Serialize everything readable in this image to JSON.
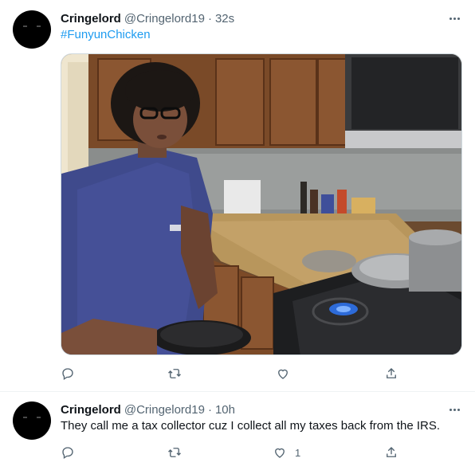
{
  "tweets": [
    {
      "author": {
        "name": "Cringelord",
        "handle": "@Cringelord19"
      },
      "separator": "·",
      "time": "32s",
      "hashtag": "#FunyunChicken",
      "has_photo": true,
      "reply_count": "",
      "retweet_count": "",
      "like_count": ""
    },
    {
      "author": {
        "name": "Cringelord",
        "handle": "@Cringelord19"
      },
      "separator": "·",
      "time": "10h",
      "text": "They call me a tax collector cuz I collect all my taxes back from the IRS.",
      "reply_count": "",
      "retweet_count": "",
      "like_count": "1"
    }
  ],
  "icons": {
    "more": "more-horizontal-icon",
    "reply": "reply-icon",
    "retweet": "retweet-icon",
    "like": "like-icon",
    "share": "share-icon"
  },
  "colors": {
    "link": "#1d9bf0",
    "secondary_text": "#536471",
    "primary_text": "#0f1419"
  }
}
